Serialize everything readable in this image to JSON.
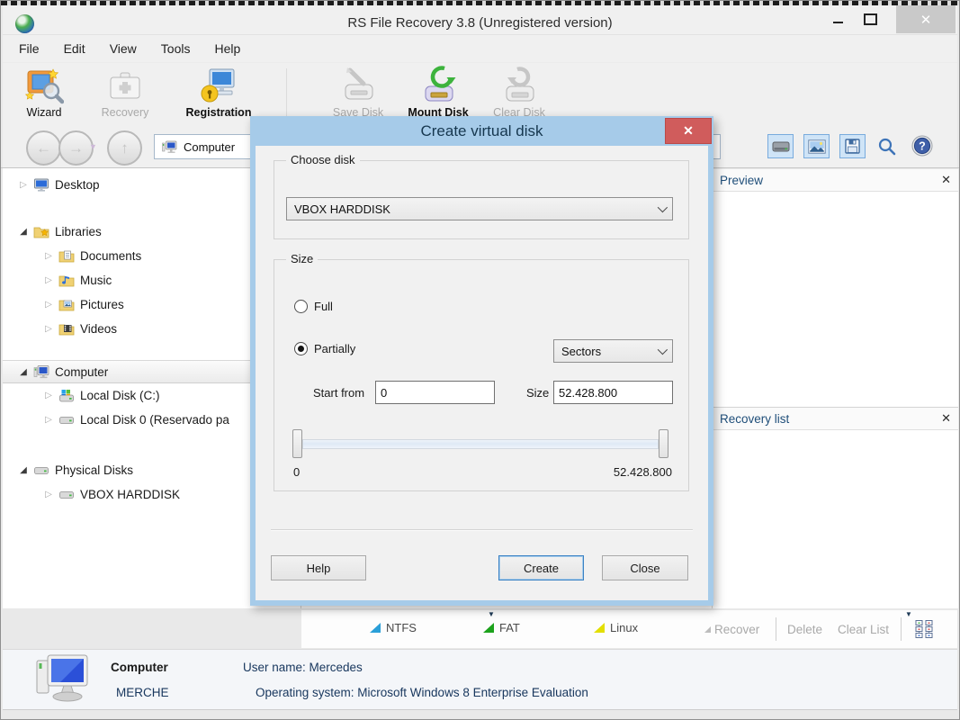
{
  "window": {
    "title": "RS File Recovery 3.8 (Unregistered version)",
    "close_glyph": "✕"
  },
  "menu": {
    "items": [
      "File",
      "Edit",
      "View",
      "Tools",
      "Help"
    ]
  },
  "toolbar": {
    "buttons": [
      {
        "label": "Wizard",
        "enabled": true
      },
      {
        "label": "Recovery",
        "enabled": false
      },
      {
        "label": "Registration",
        "enabled": true
      },
      {
        "label": "Save Disk",
        "enabled": false
      },
      {
        "label": "Mount Disk",
        "enabled": true
      },
      {
        "label": "Clear Disk",
        "enabled": false
      }
    ]
  },
  "navbar": {
    "address": "Computer"
  },
  "tree": {
    "items": [
      {
        "label": "Desktop"
      },
      {
        "label": "Libraries"
      },
      {
        "label": "Documents"
      },
      {
        "label": "Music"
      },
      {
        "label": "Pictures"
      },
      {
        "label": "Videos"
      },
      {
        "label": "Computer"
      },
      {
        "label": "Local Disk (C:)"
      },
      {
        "label": "Local Disk 0 (Reservado pa"
      },
      {
        "label": "Physical Disks"
      },
      {
        "label": "VBOX HARDDISK"
      }
    ]
  },
  "dialog": {
    "title": "Create virtual disk",
    "close_glyph": "✕",
    "choose_disk": {
      "group_label": "Choose disk",
      "selected": "VBOX HARDDISK"
    },
    "size_group": {
      "label": "Size",
      "full": "Full",
      "partially": "Partially",
      "units": "Sectors",
      "start_from_label": "Start from",
      "start_from_value": "0",
      "size_label": "Size",
      "size_value": "52.428.800",
      "slider_min": "0",
      "slider_max": "52.428.800"
    },
    "buttons": {
      "help": "Help",
      "create": "Create",
      "close": "Close"
    }
  },
  "panels": {
    "preview_title": "Preview",
    "recovery_title": "Recovery list",
    "close_glyph": "✕"
  },
  "legend": {
    "items": [
      {
        "label": "NTFS",
        "color": "#2a9fd8"
      },
      {
        "label": "FAT",
        "color": "#1ca21c"
      },
      {
        "label": "Linux",
        "color": "#e3df00"
      }
    ]
  },
  "actions": {
    "recover": "Recover",
    "delete": "Delete",
    "clear_list": "Clear List"
  },
  "status": {
    "computer_label": "Computer",
    "computer_name": "MERCHE",
    "user_name": "User name: Mercedes",
    "os": "Operating system: Microsoft Windows 8 Enterprise Evaluation"
  }
}
